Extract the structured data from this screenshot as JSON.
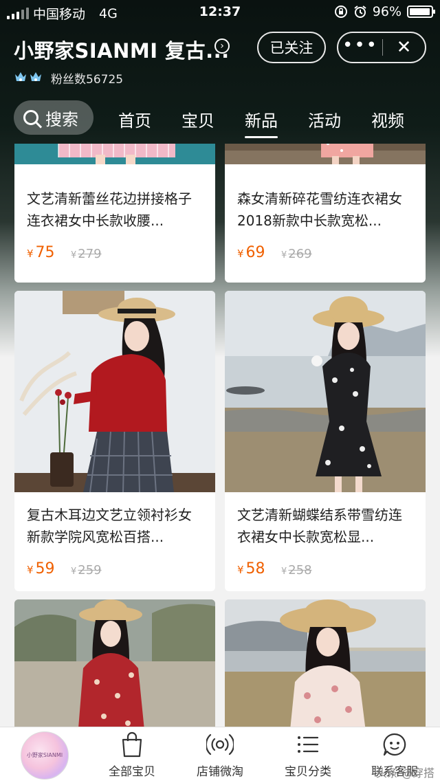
{
  "status_bar": {
    "carrier": "中国移动",
    "network": "4G",
    "time": "12:37",
    "battery": "96%",
    "battery_level": 0.96
  },
  "shop": {
    "name": "小野家SIANMI 复古...",
    "fans": "粉丝数56725",
    "follow_label": "已关注",
    "more_glyph": "•••",
    "close_glyph": "✕"
  },
  "tabs": {
    "search_label": "搜索",
    "items": [
      "首页",
      "宝贝",
      "新品",
      "活动",
      "视频"
    ],
    "active_index": 2
  },
  "products": [
    {
      "title": "文艺清新蕾丝花边拼接格子连衣裙女中长款收腰...",
      "price": "75",
      "original_price": "279",
      "yen": "¥"
    },
    {
      "title": "森女清新碎花雪纺连衣裙女2018新款中长款宽松...",
      "price": "69",
      "original_price": "269",
      "yen": "¥"
    },
    {
      "title": "复古木耳边文艺立领衬衫女新款学院风宽松百搭...",
      "price": "59",
      "original_price": "259",
      "yen": "¥"
    },
    {
      "title": "文艺清新蝴蝶结系带雪纺连衣裙女中长款宽松显...",
      "price": "58",
      "original_price": "258",
      "yen": "¥"
    }
  ],
  "bottom_nav": {
    "avatar_text": "小野家SIANMI",
    "items": [
      "全部宝贝",
      "店铺微淘",
      "宝贝分类",
      "联系客服"
    ]
  },
  "watermark": "头条 @穿搭"
}
